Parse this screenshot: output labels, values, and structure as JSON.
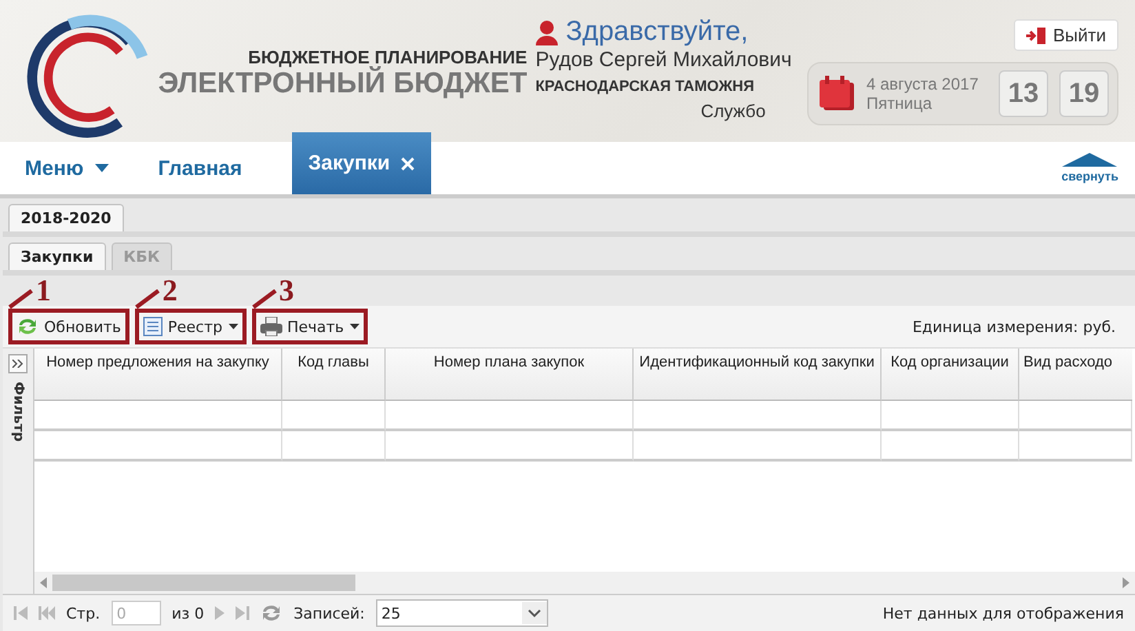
{
  "header": {
    "subtitle": "БЮДЖЕТНОЕ ПЛАНИРОВАНИЕ",
    "title": "ЭЛЕКТРОННЫЙ БЮДЖЕТ",
    "greeting": "Здравствуйте,",
    "user": "Рудов Сергей Михайлович",
    "org": "КРАСНОДАРСКАЯ ТАМОЖНЯ",
    "extra": "Службо",
    "date": "4 августа 2017",
    "weekday": "Пятница",
    "hours": "13",
    "minutes": "19",
    "logout": "Выйти"
  },
  "nav": [
    {
      "label": "Меню",
      "kind": "menu",
      "selected": false
    },
    {
      "label": "Главная",
      "kind": "link",
      "selected": false
    },
    {
      "label": "Закупки",
      "kind": "tab",
      "selected": true
    }
  ],
  "collapse": "свернуть",
  "year_tab": {
    "label": "2018-2020",
    "selected": true
  },
  "sub_tabs": [
    {
      "label": "Закупки",
      "selected": true
    },
    {
      "label": "КБК",
      "selected": false
    }
  ],
  "toolbar": [
    {
      "label": "Обновить",
      "kind": "refresh",
      "callout": "1"
    },
    {
      "label": "Реестр",
      "kind": "register",
      "callout": "2"
    },
    {
      "label": "Печать",
      "kind": "print",
      "callout": "3"
    }
  ],
  "unit": "Единица измерения: руб.",
  "filter": "Фильтр",
  "table": {
    "columns": [
      "Номер предложения на закупку",
      "Код главы",
      "Номер плана закупок",
      "Идентификационный код закупки",
      "Код организации",
      "Вид расходо"
    ]
  },
  "pager": {
    "page_label": "Стр.",
    "page": "0",
    "of": "из 0",
    "records_label": "Записей:",
    "records": "25",
    "status": "Нет данных для отображения"
  }
}
